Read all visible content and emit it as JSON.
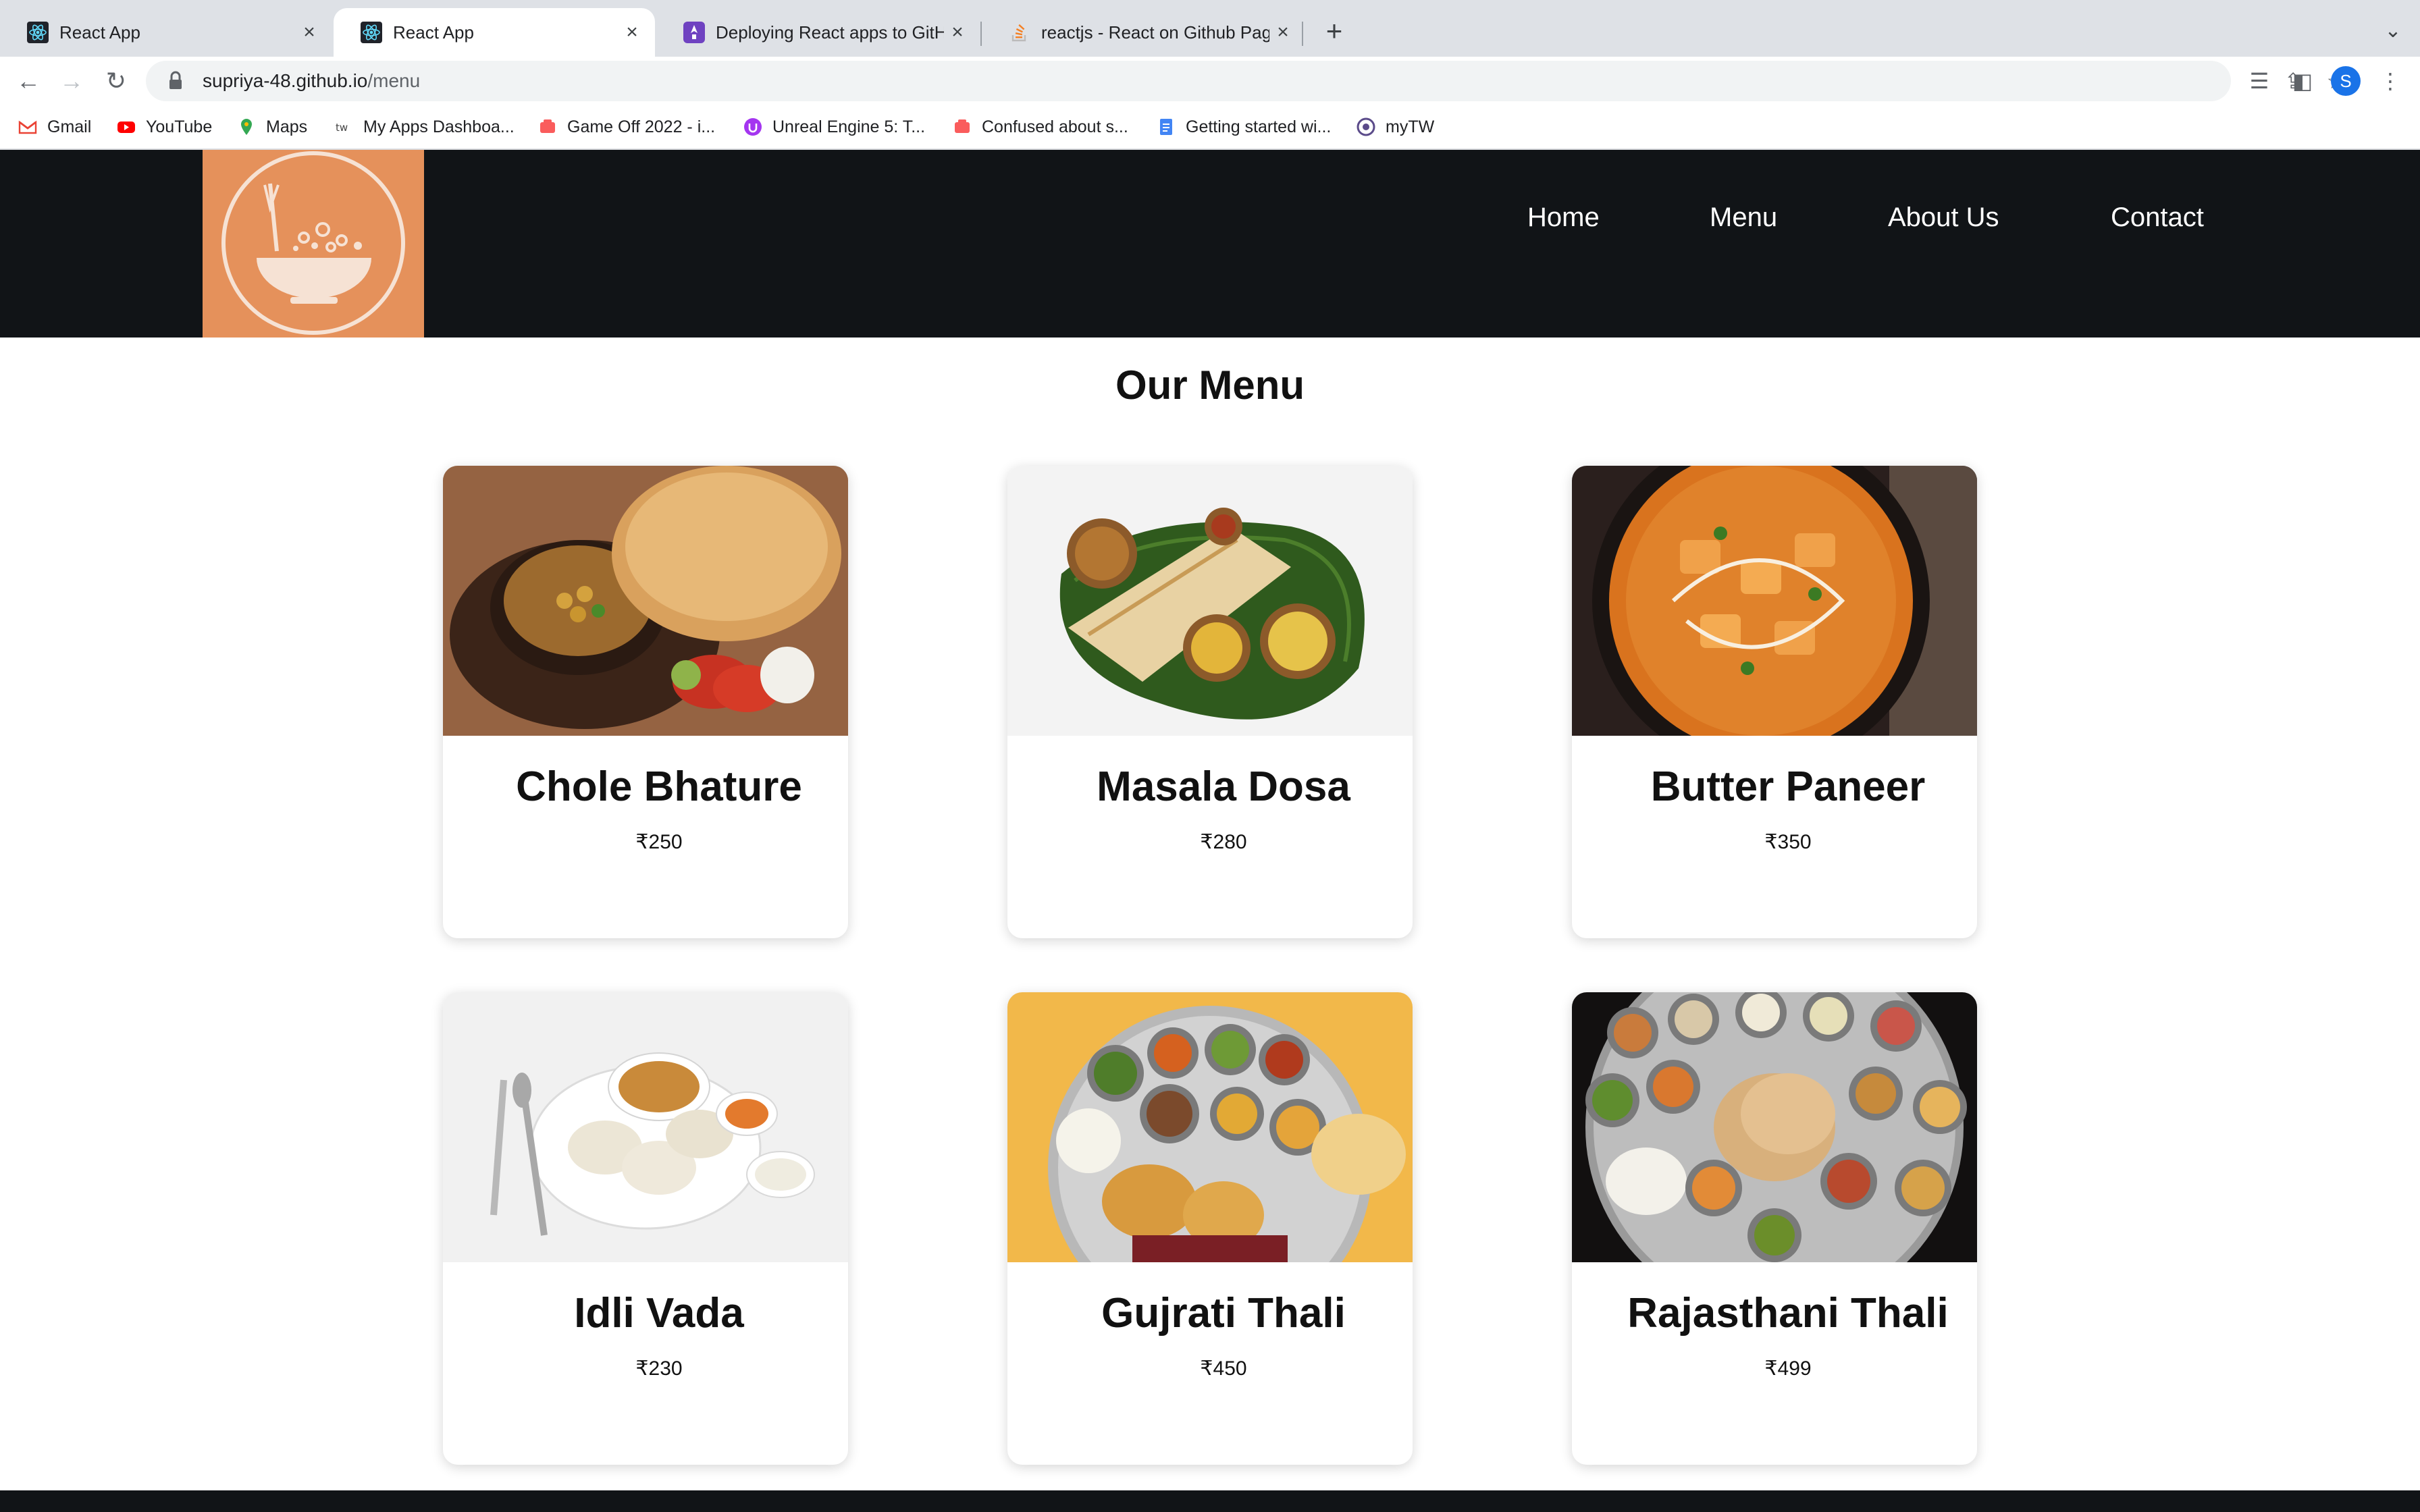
{
  "browser": {
    "tabs": [
      {
        "title": "React App",
        "active": false,
        "favicon": "react-icon"
      },
      {
        "title": "React App",
        "active": true,
        "favicon": "react-icon"
      },
      {
        "title": "Deploying React apps to GitHu",
        "active": false,
        "favicon": "rocket-icon"
      },
      {
        "title": "reactjs - React on Github Page",
        "active": false,
        "favicon": "stackoverflow-icon"
      }
    ],
    "url_host": "supriya-48.github.io",
    "url_path": "/menu",
    "profile_initial": "S",
    "bookmarks": [
      {
        "label": "Gmail",
        "icon": "gmail-icon"
      },
      {
        "label": "YouTube",
        "icon": "youtube-icon"
      },
      {
        "label": "Maps",
        "icon": "maps-icon"
      },
      {
        "label": "My Apps Dashboa...",
        "icon": "tw-icon"
      },
      {
        "label": "Game Off 2022 - i...",
        "icon": "game-icon"
      },
      {
        "label": "Unreal Engine 5: T...",
        "icon": "udemy-icon"
      },
      {
        "label": "Confused about s...",
        "icon": "game-icon"
      },
      {
        "label": "Getting started wi...",
        "icon": "docs-icon"
      },
      {
        "label": "myTW",
        "icon": "mytw-icon"
      }
    ]
  },
  "site": {
    "logo": "bowl-logo-icon",
    "nav": [
      "Home",
      "Menu",
      "About Us",
      "Contact"
    ],
    "page_title": "Our Menu",
    "menu_items": [
      {
        "name": "Chole Bhature",
        "price": "₹250"
      },
      {
        "name": "Masala Dosa",
        "price": "₹280"
      },
      {
        "name": "Butter Paneer",
        "price": "₹350"
      },
      {
        "name": "Idli Vada",
        "price": "₹230"
      },
      {
        "name": "Gujrati Thali",
        "price": "₹450"
      },
      {
        "name": "Rajasthani Thali",
        "price": "₹499"
      }
    ]
  },
  "colors": {
    "header_bg": "#111417",
    "logo_bg": "#e5915b",
    "tabstrip_bg": "#dee1e6"
  }
}
